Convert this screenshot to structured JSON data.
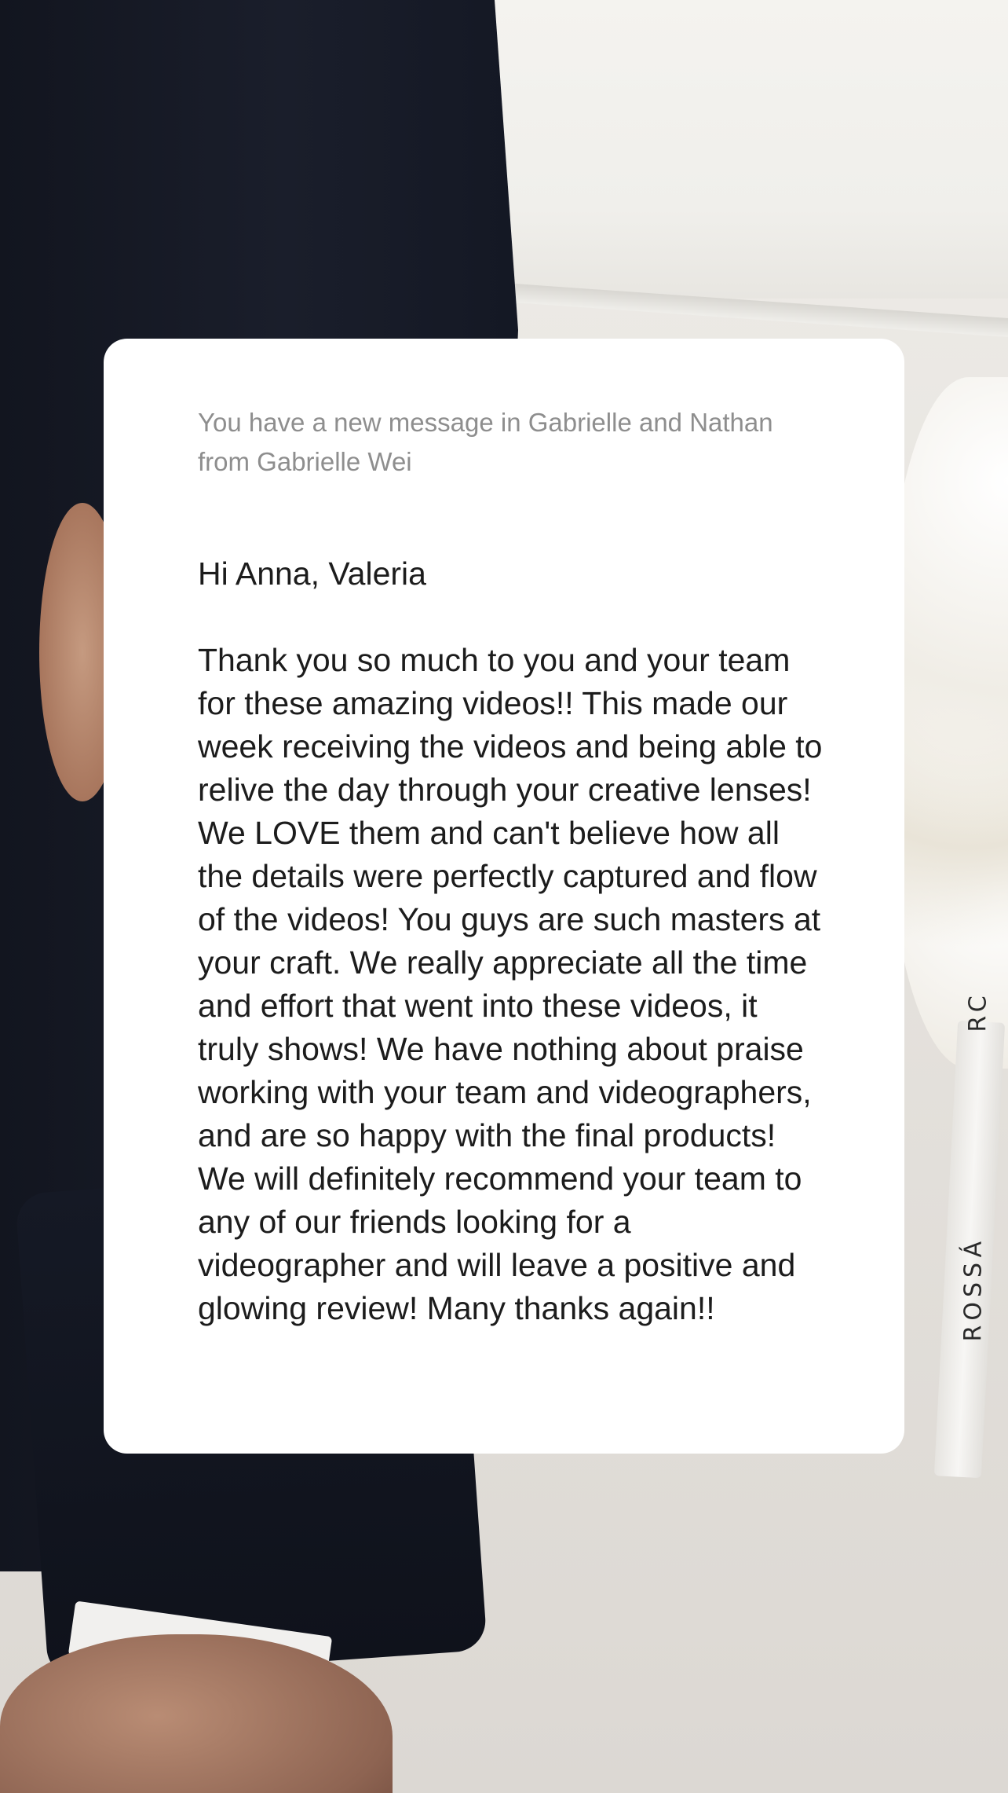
{
  "notification": {
    "text": "You have a new message in Gabrielle and Nathan from Gabrielle Wei"
  },
  "message": {
    "greeting": "Hi Anna, Valeria",
    "body": "Thank you so much to you and your team for these amazing videos!! This made our week receiving the videos and being able to relive the day through your creative lenses! We LOVE them and can't believe how all the details were perfectly captured and flow of the videos! You guys are such masters at your craft.  We really appreciate all the time and effort that went into these videos, it truly shows! We have nothing about praise working with your team and videographers, and are so happy with the final products!  We will definitely recommend your team to any of our friends looking for a videographer and will leave a positive and glowing review!  Many thanks again!!"
  },
  "background": {
    "ribbon_text": "ROSSÁ",
    "ribbon_text_partial": "RC"
  }
}
